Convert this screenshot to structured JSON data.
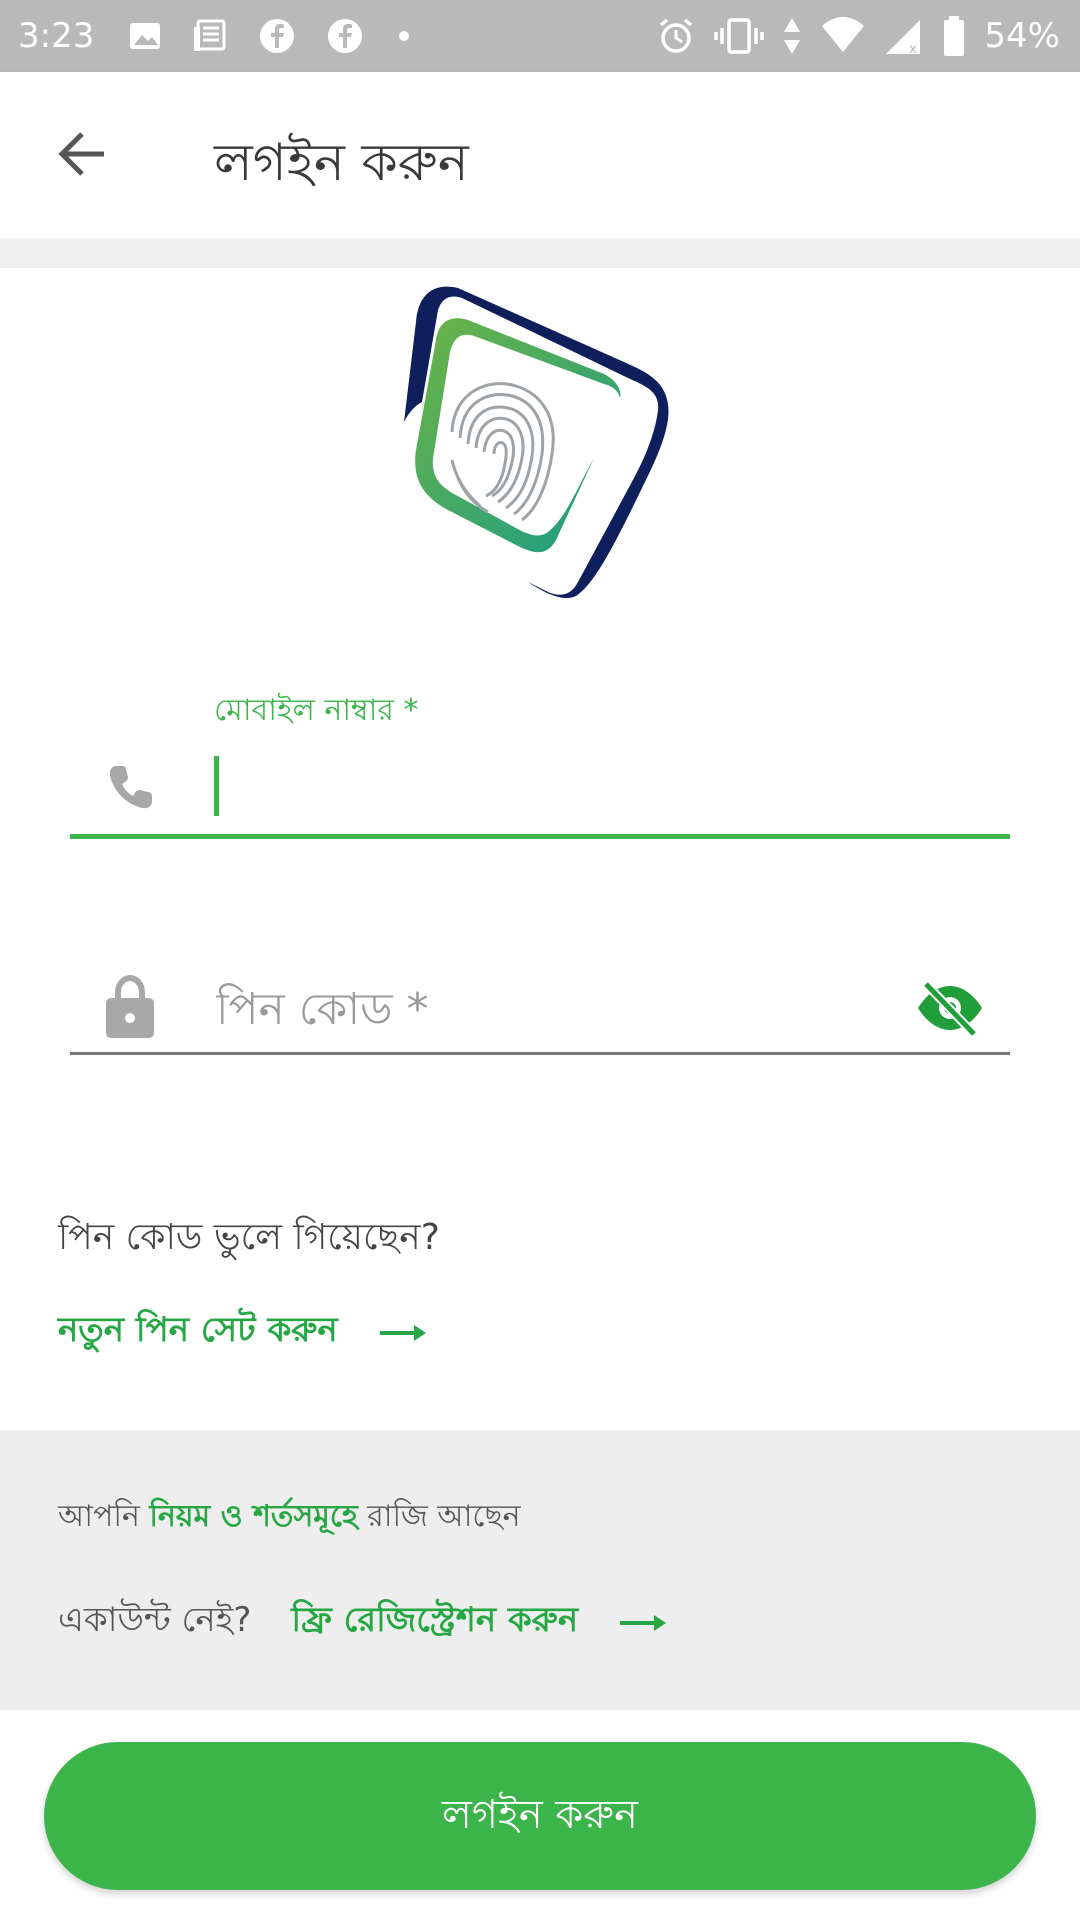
{
  "status_bar": {
    "time": "3:23",
    "battery_text": "54%",
    "left_icons": [
      "image-icon",
      "news-icon",
      "facebook-icon",
      "facebook-icon",
      "dot-icon"
    ],
    "right_icons": [
      "alarm-icon",
      "vibrate-icon",
      "data-arrows-icon",
      "wifi-icon",
      "signal-icon",
      "battery-icon"
    ]
  },
  "app_bar": {
    "title": "লগইন করুন"
  },
  "mobile_field": {
    "label": "মোবাইল নাম্বার *",
    "value": ""
  },
  "pin_field": {
    "placeholder": "পিন কোড *"
  },
  "forgot": {
    "question": "পিন কোড ভুলে গিয়েছেন?",
    "link_label": "নতুন পিন সেট করুন"
  },
  "terms": {
    "prefix": "আপনি ",
    "link": "নিয়ম ও শর্তসমূহে",
    "suffix": " রাজি আছেন"
  },
  "register": {
    "question": "একাউন্ট নেই?",
    "link_label": "ফ্রি রেজিস্ট্রেশন করুন"
  },
  "login_button": {
    "label": "লগইন করুন"
  },
  "colors": {
    "accent": "#3bb54a",
    "link_green": "#27a744",
    "logo_navy": "#0e1f5c",
    "status_bar": "#b9b9b9"
  }
}
